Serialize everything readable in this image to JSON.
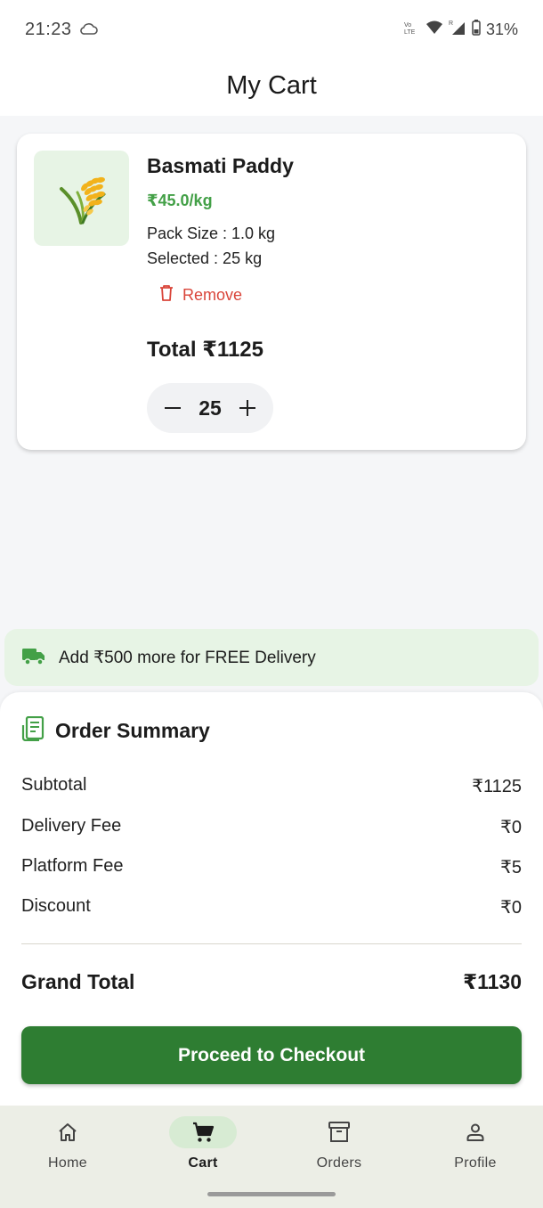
{
  "status_bar": {
    "time": "21:23",
    "battery": "31%"
  },
  "header": {
    "title": "My Cart"
  },
  "cart_item": {
    "name": "Basmati Paddy",
    "price": "₹45.0/kg",
    "pack_size": "Pack Size : 1.0 kg",
    "selected": "Selected : 25 kg",
    "remove_label": "Remove",
    "total": "Total ₹1125",
    "quantity": "25"
  },
  "delivery_banner": {
    "text": "Add ₹500 more for FREE Delivery"
  },
  "summary": {
    "title": "Order Summary",
    "rows": [
      {
        "label": "Subtotal",
        "value": "₹1125"
      },
      {
        "label": "Delivery Fee",
        "value": "₹0"
      },
      {
        "label": "Platform Fee",
        "value": "₹5"
      },
      {
        "label": "Discount",
        "value": "₹0"
      }
    ],
    "grand_total_label": "Grand Total",
    "grand_total_value": "₹1130",
    "checkout_label": "Proceed to Checkout"
  },
  "bottom_nav": {
    "items": [
      {
        "label": "Home",
        "icon": "home-icon"
      },
      {
        "label": "Cart",
        "icon": "cart-icon",
        "active": true
      },
      {
        "label": "Orders",
        "icon": "archive-box-icon"
      },
      {
        "label": "Profile",
        "icon": "person-icon"
      }
    ]
  },
  "colors": {
    "brand_green": "#2e7d32",
    "price_green": "#43a047",
    "remove_red": "#d9453a",
    "light_green_bg": "#e7f4e5"
  }
}
